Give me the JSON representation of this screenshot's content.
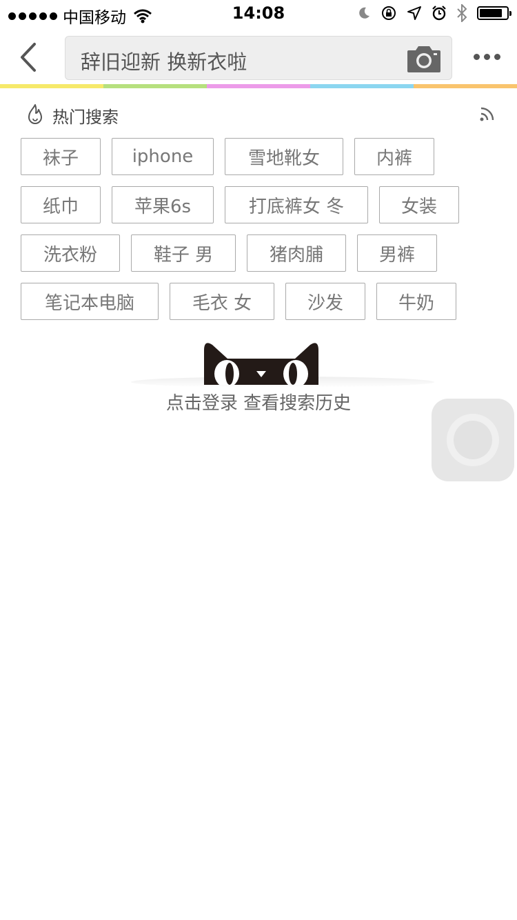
{
  "status_bar": {
    "carrier": "中国移动",
    "time": "14:08",
    "battery_level": 0.85
  },
  "nav": {
    "search_text": "辞旧迎新 换新衣啦"
  },
  "hot_search": {
    "title": "热门搜索",
    "rows": [
      [
        "袜子",
        "iphone",
        "雪地靴女",
        "内裤"
      ],
      [
        "纸巾",
        "苹果6s",
        "打底裤女 冬",
        "女装"
      ],
      [
        "洗衣粉",
        "鞋子 男",
        "猪肉脯",
        "男裤"
      ],
      [
        "笔记本电脑",
        "毛衣 女",
        "沙发",
        "牛奶"
      ]
    ]
  },
  "history": {
    "login_text": "点击登录 查看搜索历史"
  },
  "colors": {
    "rainbow": [
      "#f6e96a",
      "#b6e07e",
      "#ec9be9",
      "#8bd6f0",
      "#f9c46d"
    ],
    "tag_border": "#a9a9a9",
    "cat": "#231a17"
  },
  "icons": {
    "back": "chevron-left-icon",
    "camera": "camera-icon",
    "more": "more-dots-icon",
    "fire": "fire-icon",
    "rss": "feed-icon"
  }
}
